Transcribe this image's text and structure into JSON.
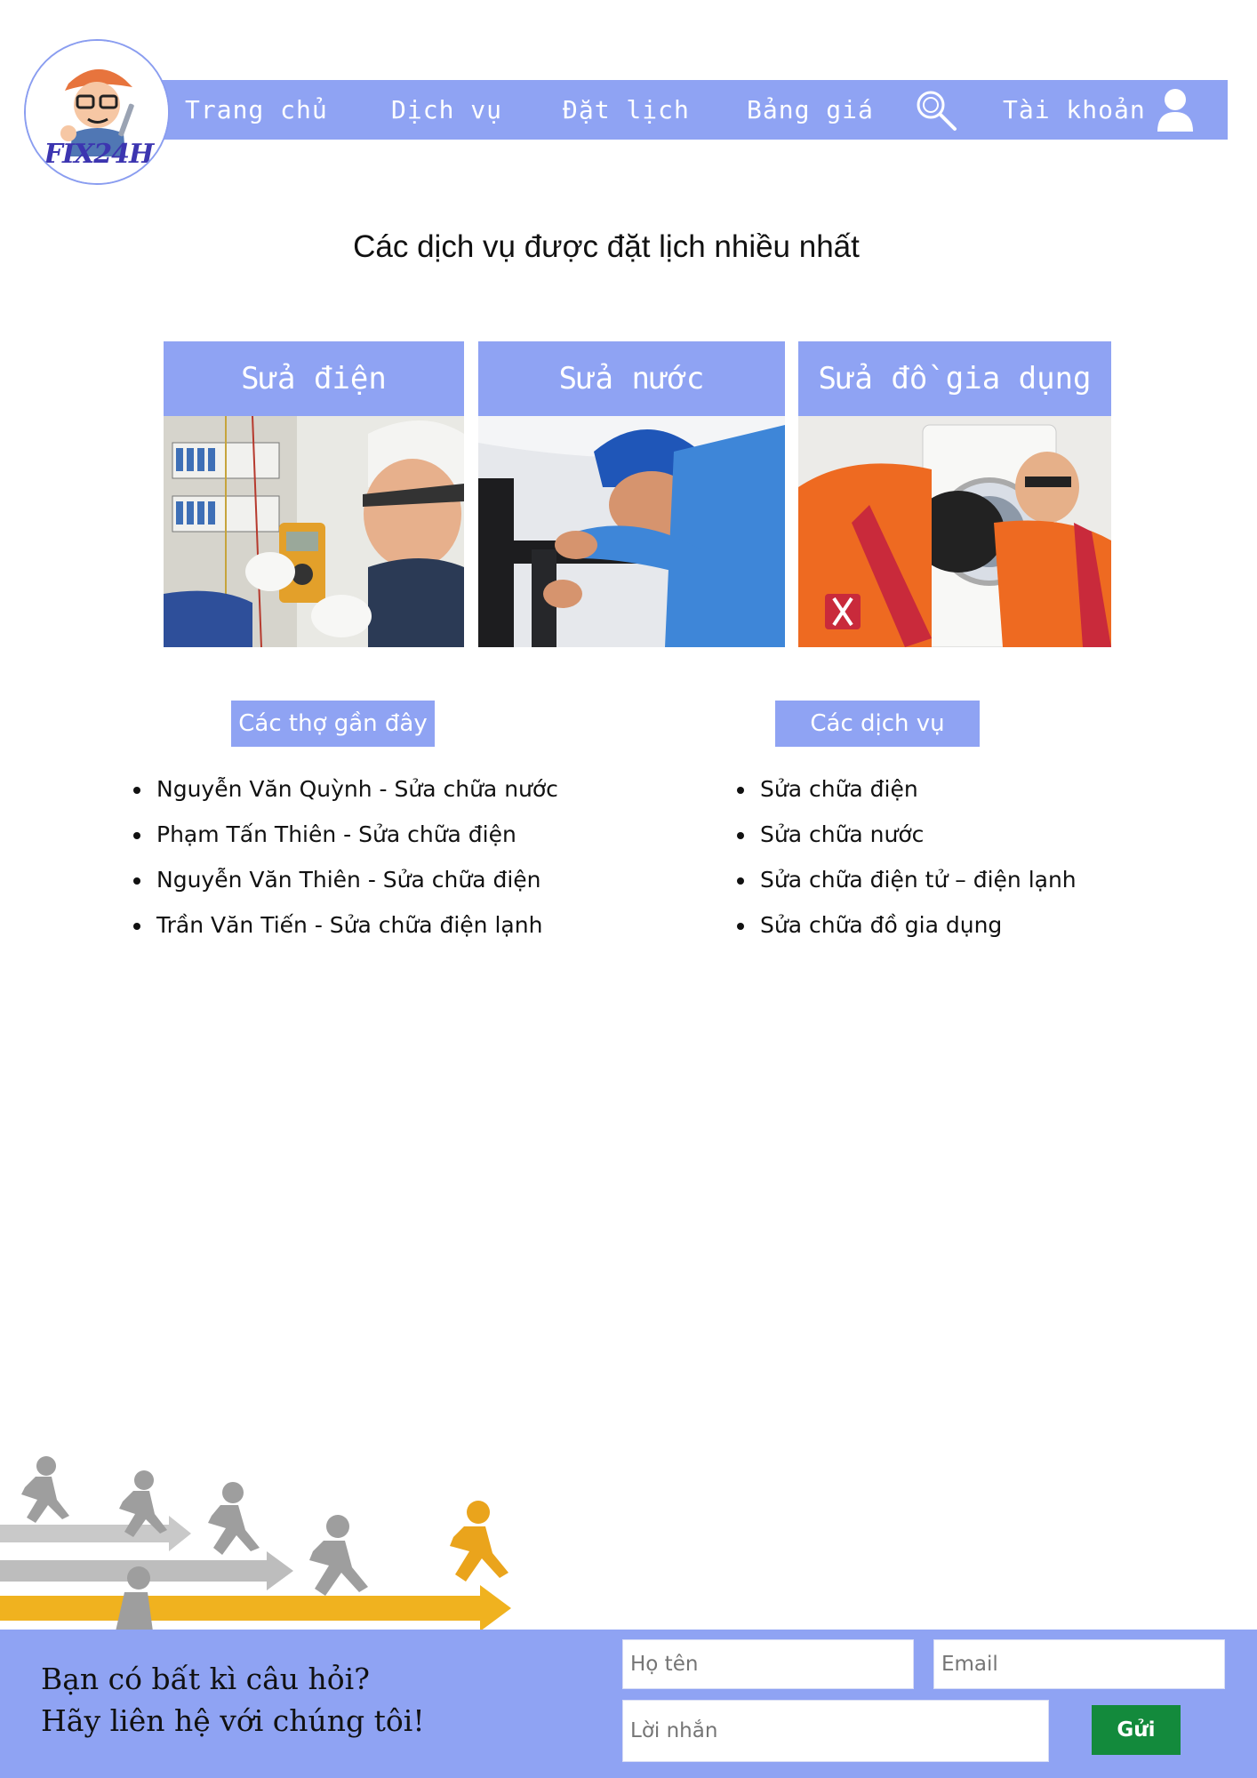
{
  "brand": {
    "logo_text": "FIX24H",
    "accent_color": "#8fa3f3"
  },
  "nav": {
    "items": [
      "Trang chủ",
      "Dịch vụ",
      "Đặt lịch",
      "Bảng giá"
    ],
    "search_icon": "search-icon",
    "account_label": "Tài khoản",
    "account_icon": "user-icon"
  },
  "main": {
    "title": "Các dịch vụ được đặt lịch nhiều nhất",
    "cards": [
      {
        "label": "Sửa điện"
      },
      {
        "label": "Sửa nước"
      },
      {
        "label": "Sửa đồ gia dụng"
      }
    ]
  },
  "recent_workers": {
    "heading": "Các thợ gần đây",
    "items": [
      "Nguyễn Văn Quỳnh - Sửa chữa nước",
      "Phạm Tấn Thiên - Sửa chữa điện",
      "Nguyễn Văn Thiên - Sửa chữa điện",
      "Trần Văn Tiến - Sửa chữa điện lạnh"
    ]
  },
  "services": {
    "heading": "Các dịch vụ",
    "items": [
      "Sửa chữa điện",
      "Sửa chữa nước",
      "Sửa chữa điện tử – điện lạnh",
      "Sửa chữa đồ gia dụng"
    ]
  },
  "contact": {
    "line1": "Bạn có bất kì câu hỏi?",
    "line2": "Hãy liên hệ với chúng tôi!",
    "name_placeholder": "Họ tên",
    "email_placeholder": "Email",
    "message_placeholder": "Lời nhắn",
    "submit_label": "Gửi",
    "submit_color": "#138a3c"
  }
}
